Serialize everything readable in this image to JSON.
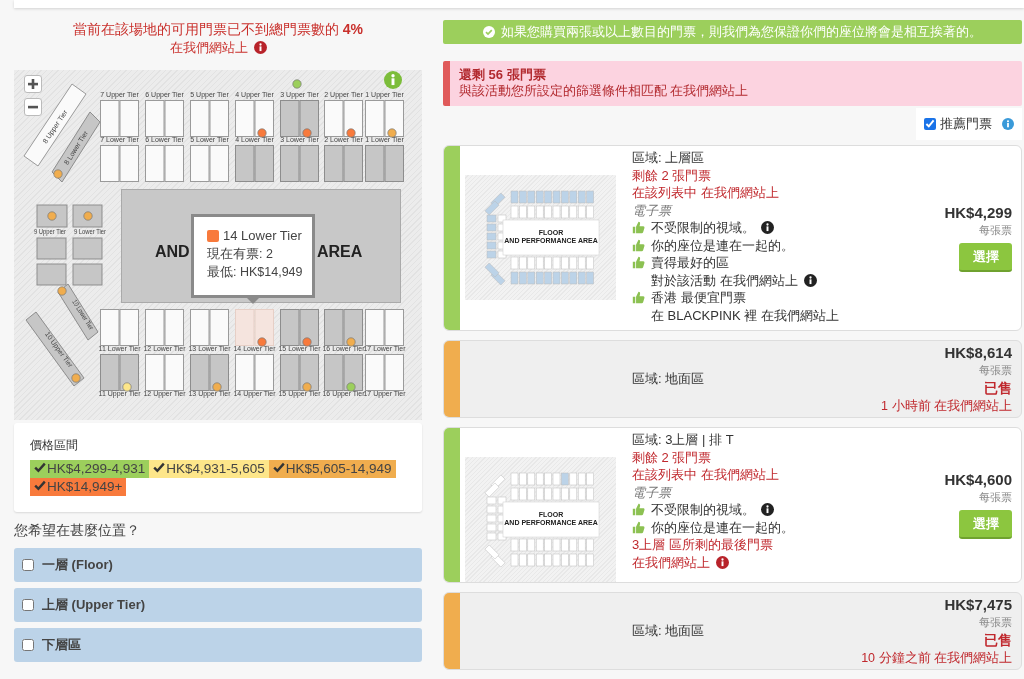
{
  "availability_warning": {
    "text": "當前在該場地的可用門票已不到總門票數的 **4%**",
    "sub": "在我們網站上"
  },
  "seat_map": {
    "floor_text": [
      "AND",
      "AREA"
    ],
    "top_upper": [
      {
        "label": "7 Upper Tier",
        "has_tickets": false,
        "selected": false
      },
      {
        "label": "6 Upper Tier",
        "has_tickets": false,
        "selected": false
      },
      {
        "label": "5 Upper Tier",
        "has_tickets": false,
        "selected": false
      },
      {
        "label": "4 Upper Tier",
        "has_tickets": false,
        "selected": false,
        "color": "#f87a3c"
      },
      {
        "label": "3 Upper Tier",
        "has_tickets": true,
        "selected": false,
        "color": "#f87a3c",
        "outer_dot": {
          "color": "#9ccf5c"
        }
      },
      {
        "label": "2 Upper Tier",
        "has_tickets": false,
        "selected": false,
        "color": "#f87a3c"
      },
      {
        "label": "1 Upper Tier",
        "has_tickets": false,
        "selected": false,
        "color": "#f0ad4e"
      }
    ],
    "top_lower": [
      {
        "label": "7 Lower Tier",
        "has_tickets": false,
        "selected": false
      },
      {
        "label": "6 Lower Tier",
        "has_tickets": false,
        "selected": false
      },
      {
        "label": "5 Lower Tier",
        "has_tickets": false,
        "selected": false
      },
      {
        "label": "4 Lower Tier",
        "has_tickets": true,
        "selected": false
      },
      {
        "label": "3 Lower Tier",
        "has_tickets": true,
        "selected": false
      },
      {
        "label": "2 Lower Tier",
        "has_tickets": true,
        "selected": false
      },
      {
        "label": "1 Lower Tier",
        "has_tickets": true,
        "selected": false
      }
    ],
    "bottom_lower": [
      {
        "label": "11 Lower Tier",
        "has_tickets": false,
        "selected": false
      },
      {
        "label": "12 Lower Tier",
        "has_tickets": false,
        "selected": false
      },
      {
        "label": "13 Lower Tier",
        "has_tickets": false,
        "selected": false
      },
      {
        "label": "14 Lower Tier",
        "has_tickets": false,
        "selected": true,
        "color": "#f87a3c"
      },
      {
        "label": "15 Lower Tier",
        "has_tickets": true,
        "selected": false,
        "color": "#f87a3c"
      },
      {
        "label": "16 Lower Tier",
        "has_tickets": true,
        "selected": false,
        "color": "#f0ad4e"
      },
      {
        "label": "17 Lower Tier",
        "has_tickets": false,
        "selected": false
      }
    ],
    "bottom_upper": [
      {
        "label": "11 Upper Tier",
        "has_tickets": true,
        "selected": false,
        "color": "#fde68a"
      },
      {
        "label": "12 Upper Tier",
        "has_tickets": false,
        "selected": false
      },
      {
        "label": "13 Upper Tier",
        "has_tickets": true,
        "selected": false,
        "color": "#f0ad4e"
      },
      {
        "label": "14 Upper Tier",
        "has_tickets": false,
        "selected": false
      },
      {
        "label": "15 Upper Tier",
        "has_tickets": true,
        "selected": false,
        "color": "#f0ad4e"
      },
      {
        "label": "16 Upper Tier",
        "has_tickets": true,
        "selected": false,
        "color": "#9ccf5c"
      },
      {
        "label": "17 Upper Tier",
        "has_tickets": false,
        "selected": false
      }
    ],
    "left": [
      {
        "label": "8 Upper Tier",
        "has_tickets": false,
        "selected": false
      },
      {
        "label": "8 Lower Tier",
        "has_tickets": true,
        "selected": false,
        "color": "#f0ad4e"
      },
      {
        "label": "9 Upper Tier",
        "has_tickets": true,
        "selected": false,
        "color": "#f0ad4e"
      },
      {
        "label": "9 Lower Tier",
        "has_tickets": true,
        "selected": false,
        "color": "#f0ad4e"
      },
      {
        "label": "10 Lower Tier",
        "has_tickets": true,
        "selected": false,
        "color": "#f0ad4e"
      },
      {
        "label": "10 Upper Tier",
        "has_tickets": true,
        "selected": false,
        "color": "#f0ad4e"
      }
    ],
    "tooltip": {
      "section": "14 Lower Tier",
      "color": "#f87a3c",
      "available": "現在有票: 2",
      "lowest": "最低: HK$14,949"
    }
  },
  "price_legend": {
    "title": "價格區間",
    "ranges": [
      {
        "label": "HK$4,299-4,931",
        "color": "#9ccf5c",
        "checked": true
      },
      {
        "label": "HK$4,931-5,605",
        "color": "#fde68a",
        "checked": true
      },
      {
        "label": "HK$5,605-14,949",
        "color": "#f0ad4e",
        "checked": true
      },
      {
        "label": "HK$14,949+",
        "color": "#f87a3c",
        "checked": true
      }
    ]
  },
  "position_question": "您希望在甚麼位置？",
  "position_filters": [
    {
      "label": "一層 (Floor)",
      "checked": false
    },
    {
      "label": "上層 (Upper Tier)",
      "checked": false
    },
    {
      "label": "下層區",
      "checked": false
    }
  ],
  "together_banner": "如果您購買兩張或以上數目的門票，則我們為您保證你們的座位將會是相互挨著的。",
  "tickets_alert": {
    "title": "還剩 56 張門票",
    "text": "與該活動您所設定的篩選條件相匹配 在我們網站上"
  },
  "recommended": {
    "label": "推薦門票",
    "checked": true
  },
  "listings": [
    {
      "kind": "available",
      "color": "#9ccf5c",
      "thumbnail": {
        "upper_tier_selected": true,
        "section_selected": false,
        "labels": [
          "FLOOR",
          "AND PERFORMANCE AREA"
        ]
      },
      "zone": "區域: 上層區",
      "remaining": "剩餘 2 張門票",
      "in_list": "在該列表中 在我們網站上",
      "ticket_type": "電子票",
      "features": [
        {
          "text": "不受限制的視域。",
          "info": true
        },
        {
          "text": "你的座位是連在一起的。",
          "info": false
        },
        {
          "text": "賣得最好的區",
          "sub": "對於該活動 在我們網站上",
          "info": true
        },
        {
          "text": "香港 最便宜門票",
          "sub": "在 BLACKPINK 裡 在我們網站上",
          "info": false
        }
      ],
      "price": "HK$4,299",
      "per": "每張票",
      "button": "選擇"
    },
    {
      "kind": "sold",
      "color": "#f0ad4e",
      "zone": "區域: 地面區",
      "price": "HK$8,614",
      "per": "每張票",
      "status": "已售",
      "time": "1 小時前 在我們網站上"
    },
    {
      "kind": "available",
      "color": "#9ccf5c",
      "thumbnail": {
        "upper_tier_selected": false,
        "section_selected": true,
        "labels": [
          "FLOOR",
          "AND PERFORMANCE AREA"
        ]
      },
      "zone": "區域: 3上層 | 排 T",
      "remaining": "剩餘 2 張門票",
      "in_list": "在該列表中 在我們網站上",
      "ticket_type": "電子票",
      "features": [
        {
          "text": "不受限制的視域。",
          "info": true
        },
        {
          "text": "你的座位是連在一起的。",
          "info": false
        }
      ],
      "notice": "3上層 區所剩的最後門票",
      "notice_sub": "在我們網站上",
      "price": "HK$4,600",
      "per": "每張票",
      "button": "選擇"
    },
    {
      "kind": "sold",
      "color": "#f0ad4e",
      "zone": "區域: 地面區",
      "price": "HK$7,475",
      "per": "每張票",
      "status": "已售",
      "time": "10 分鐘之前 在我們網站上"
    }
  ]
}
